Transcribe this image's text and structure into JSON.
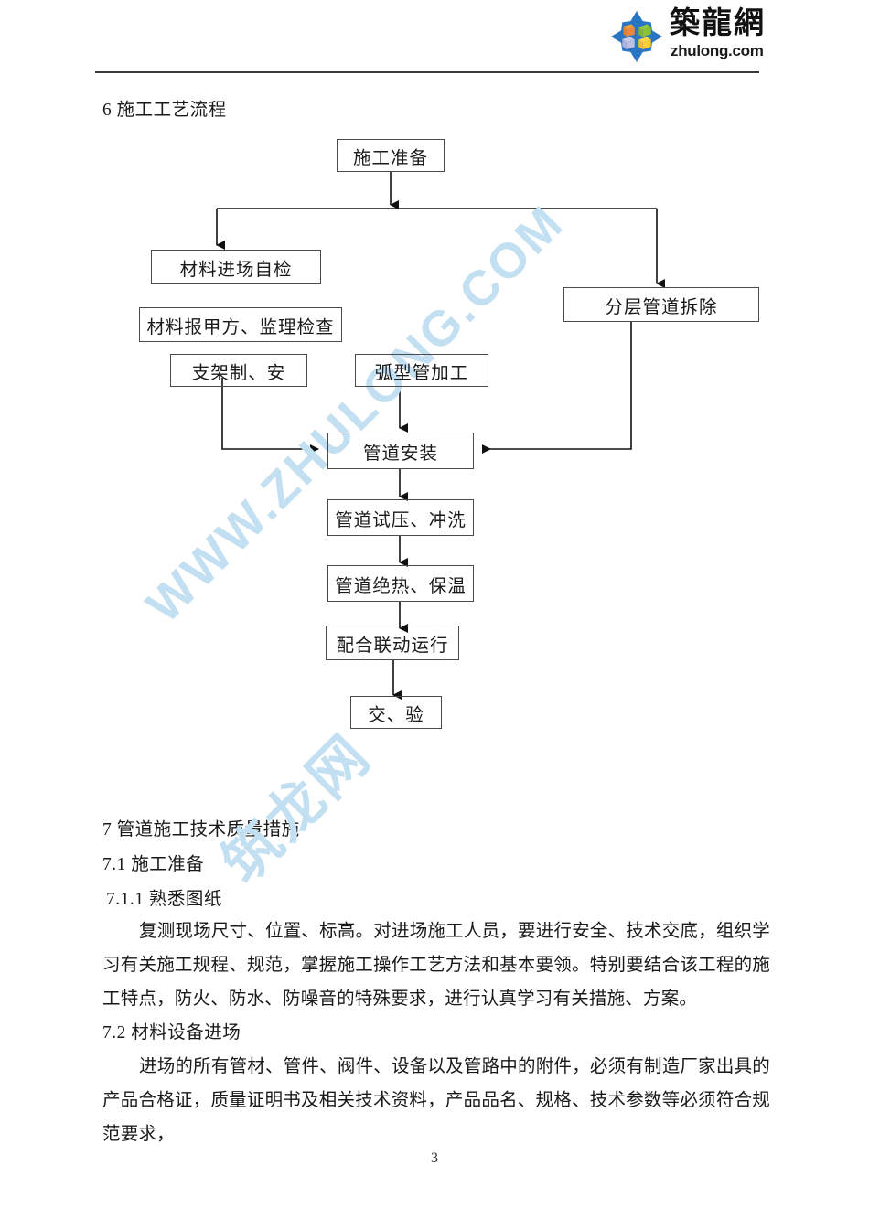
{
  "header": {
    "logo_cn": "築龍網",
    "logo_en": "zhulong.com",
    "logo_icon": "zhulong-diamond-cubes-logo"
  },
  "watermark": {
    "url_text": "WWW.ZHULONG.COM",
    "cn_text": "筑龙网",
    "color": "#c3dff2"
  },
  "sections": {
    "s6_title": "6    施工工艺流程",
    "s7_title": "7    管道施工技术质量措施",
    "s71_title": "7.1 施工准备",
    "s711_title": "7.1.1 熟悉图纸",
    "s711_body": "复测现场尺寸、位置、标高。对进场施工人员，要进行安全、技术交底，组织学习有关施工规程、规范，掌握施工操作工艺方法和基本要领。特别要结合该工程的施工特点，防火、防水、防噪音的特殊要求，进行认真学习有关措施、方案。",
    "s72_title": "7.2 材料设备进场",
    "s72_body": "进场的所有管材、管件、阀件、设备以及管路中的附件，必须有制造厂家出具的产品合格证，质量证明书及相关技术资料，产品品名、规格、技术参数等必须符合规范要求，"
  },
  "flowchart": {
    "boxes": [
      {
        "id": "prep",
        "label": "施工准备"
      },
      {
        "id": "self-check",
        "label": "材料进场自检"
      },
      {
        "id": "demolition",
        "label": "分层管道拆除"
      },
      {
        "id": "report",
        "label": "材料报甲方、监理检查"
      },
      {
        "id": "bracket",
        "label": "支架制、安"
      },
      {
        "id": "arc-pipe",
        "label": "弧型管加工"
      },
      {
        "id": "install",
        "label": "管道安装"
      },
      {
        "id": "pressure",
        "label": "管道试压、冲洗"
      },
      {
        "id": "insulation",
        "label": "管道绝热、保温"
      },
      {
        "id": "commission",
        "label": "配合联动运行"
      },
      {
        "id": "handover",
        "label": "交、验"
      }
    ]
  },
  "footer": {
    "page_number": "3"
  }
}
